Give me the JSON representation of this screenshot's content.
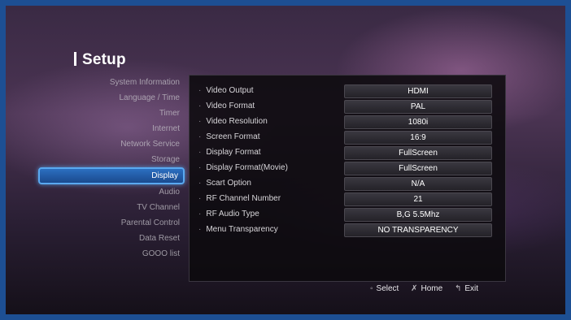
{
  "title": "Setup",
  "sidebar": {
    "items": [
      {
        "label": "System Information"
      },
      {
        "label": "Language / Time"
      },
      {
        "label": "Timer"
      },
      {
        "label": "Internet"
      },
      {
        "label": "Network Service"
      },
      {
        "label": "Storage"
      },
      {
        "label": "Display"
      },
      {
        "label": "Audio"
      },
      {
        "label": "TV Channel"
      },
      {
        "label": "Parental Control"
      },
      {
        "label": "Data Reset"
      },
      {
        "label": "GOOO list"
      }
    ],
    "active": "Display"
  },
  "settings": [
    {
      "label": "Video Output",
      "value": "HDMI"
    },
    {
      "label": "Video Format",
      "value": "PAL"
    },
    {
      "label": "Video Resolution",
      "value": "1080i"
    },
    {
      "label": "Screen Format",
      "value": "16:9"
    },
    {
      "label": "Display Format",
      "value": "FullScreen"
    },
    {
      "label": "Display Format(Movie)",
      "value": "FullScreen"
    },
    {
      "label": "Scart Option",
      "value": "N/A"
    },
    {
      "label": "RF Channel Number",
      "value": "21"
    },
    {
      "label": "RF Audio Type",
      "value": "B,G 5.5Mhz"
    },
    {
      "label": "Menu Transparency",
      "value": "NO TRANSPARENCY"
    }
  ],
  "footer": {
    "select_key": "◦",
    "select_label": "Select",
    "home_key": "✗",
    "home_label": "Home",
    "exit_key": "↰",
    "exit_label": "Exit"
  },
  "colors": {
    "highlight": "#2c6fc0",
    "highlight_border": "#5aa9f0",
    "frame": "#1d4f93"
  }
}
